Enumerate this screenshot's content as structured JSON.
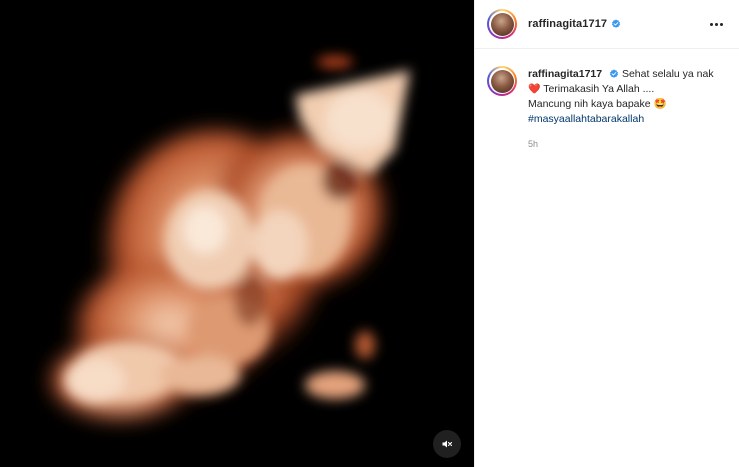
{
  "post": {
    "username": "raffinagita1717",
    "verified": true,
    "media": {
      "type": "video",
      "description_icon": "ultrasound-3d-image",
      "mute_icon": "speaker-muted-icon"
    }
  },
  "caption": {
    "username": "raffinagita1717",
    "line1": "Sehat selalu ya nak",
    "heart": "❤️",
    "line2": "Terimakasih Ya Allah ....",
    "line3": "Mancung nih kaya bapake",
    "emoji": "🤩",
    "hashtag": "#masyaallahtabarakallah",
    "time": "5h"
  },
  "colors": {
    "verified_blue": "#3897f0",
    "hashtag": "#00376b",
    "heart": "#e0245e",
    "muted_text": "#8e8e8e"
  }
}
